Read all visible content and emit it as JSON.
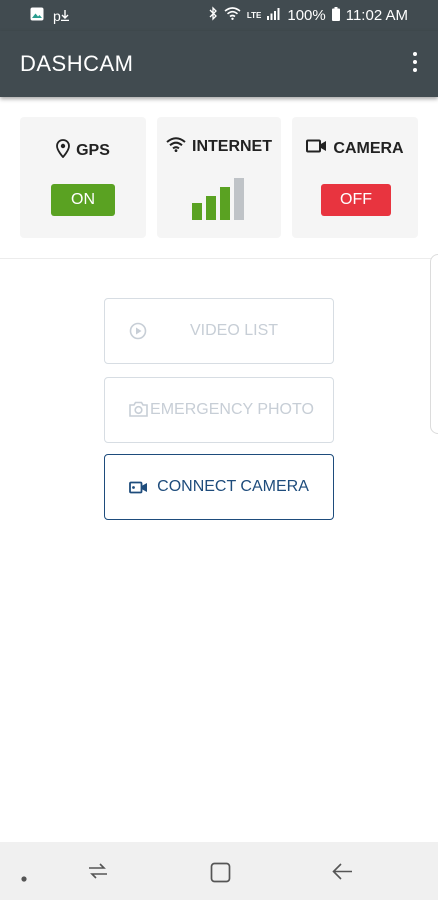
{
  "status_bar": {
    "left_icons": [
      "gallery-icon",
      "p-notification-icon"
    ],
    "p_letter": "p",
    "right_icons": [
      "bluetooth-icon",
      "wifi-icon",
      "lte-icon",
      "signal-icon",
      "battery-icon"
    ],
    "lte_label": "LTE",
    "battery": "100%",
    "time": "11:02 AM"
  },
  "app_bar": {
    "title": "DASHCAM",
    "menu_icon": "more-vert-icon"
  },
  "status_cards": {
    "gps": {
      "label": "GPS",
      "icon": "location-pin-icon",
      "state": "ON",
      "color": "#5aa222"
    },
    "internet": {
      "label": "INTERNET",
      "icon": "wifi-icon",
      "signal_bars_active": 3,
      "signal_bars_total": 4,
      "active_color": "#5aa222",
      "inactive_color": "#bfc3c7"
    },
    "camera": {
      "label": "CAMERA",
      "icon": "video-camera-icon",
      "state": "OFF",
      "color": "#e8343f"
    }
  },
  "actions": {
    "video_list": {
      "label": "VIDEO LIST",
      "icon": "play-circle-icon",
      "enabled": false
    },
    "emergency_photo": {
      "label": "EMERGENCY PHOTO",
      "icon": "camera-icon",
      "enabled": false
    },
    "connect_camera": {
      "label": "CONNECT CAMERA",
      "icon": "video-camera-icon",
      "enabled": true
    }
  },
  "colors": {
    "bar_bg": "#414b50",
    "accent_blue": "#1e4c7c",
    "disabled_text": "#c7ced6"
  },
  "nav_bar": {
    "items": [
      "dot-icon",
      "recent-apps-icon",
      "home-icon",
      "back-icon"
    ]
  }
}
